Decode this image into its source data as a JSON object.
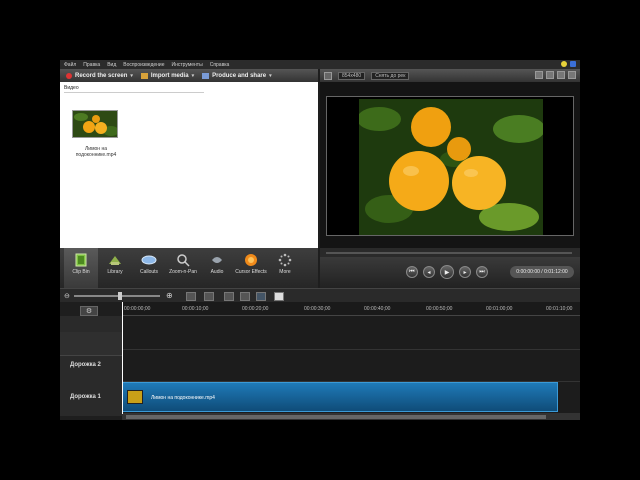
{
  "menu": [
    "Файл",
    "Правка",
    "Вид",
    "Воспроизведение",
    "Инструменты",
    "Справка"
  ],
  "toolbar": {
    "record": "Record the screen",
    "import": "Import media",
    "produce": "Produce and share"
  },
  "bin": {
    "header": "Видео",
    "clip_name": "Лимон на подоконнике.mp4"
  },
  "tools": [
    {
      "label": "Clip Bin",
      "icon": "film-icon",
      "active": true
    },
    {
      "label": "Library",
      "icon": "library-icon"
    },
    {
      "label": "Callouts",
      "icon": "callout-icon"
    },
    {
      "label": "Zoom-n-Pan",
      "icon": "magnifier-icon"
    },
    {
      "label": "Audio",
      "icon": "audio-icon"
    },
    {
      "label": "Cursor Effects",
      "icon": "cursor-effects-icon"
    },
    {
      "label": "More",
      "icon": "more-icon"
    }
  ],
  "preview": {
    "resolution": "854x480",
    "fit": "Снять до рeк",
    "time": "0:00:00:00 / 0:01:12:00"
  },
  "timeline": {
    "ticks": [
      "00:00:00;00",
      "00:00:10;00",
      "00:00:20;00",
      "00:00:30;00",
      "00:00:40;00",
      "00:00:50;00",
      "00:01:00;00",
      "00:01:10;00"
    ],
    "tracks": [
      "Дорожка 2",
      "Дорожка 1"
    ],
    "clip_label": "Лимон на подоконнике.mp4"
  },
  "colors": {
    "record_dot": "#d33",
    "clip_blue": "#1f7ab8"
  }
}
